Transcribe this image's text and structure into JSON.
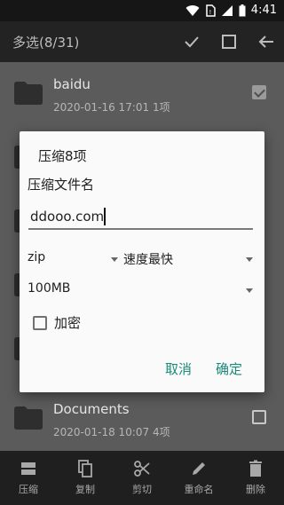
{
  "status_bar": {
    "time": "4:41"
  },
  "app_bar": {
    "title": "多选(8/31)"
  },
  "files": [
    {
      "name": "baidu",
      "meta": "2020-01-16 17:01  1项",
      "checked": true
    },
    {
      "name": "",
      "meta": "",
      "checked": false
    },
    {
      "name": "",
      "meta": "",
      "checked": false
    },
    {
      "name": "",
      "meta": "",
      "checked": false
    },
    {
      "name": "",
      "meta": "",
      "checked": false
    },
    {
      "name": "Documents",
      "meta": "2020-01-18 10:07  4项",
      "checked": false
    }
  ],
  "dialog": {
    "title": "压缩8项",
    "name_label": "压缩文件名",
    "name_value": "ddooo.com",
    "format": "zip",
    "speed": "速度最快",
    "volume_size": "100MB",
    "encrypt_label": "加密",
    "cancel": "取消",
    "ok": "确定"
  },
  "bottom_bar": {
    "compress": "压缩",
    "copy": "复制",
    "cut": "剪切",
    "rename": "重命名",
    "delete": "删除"
  }
}
